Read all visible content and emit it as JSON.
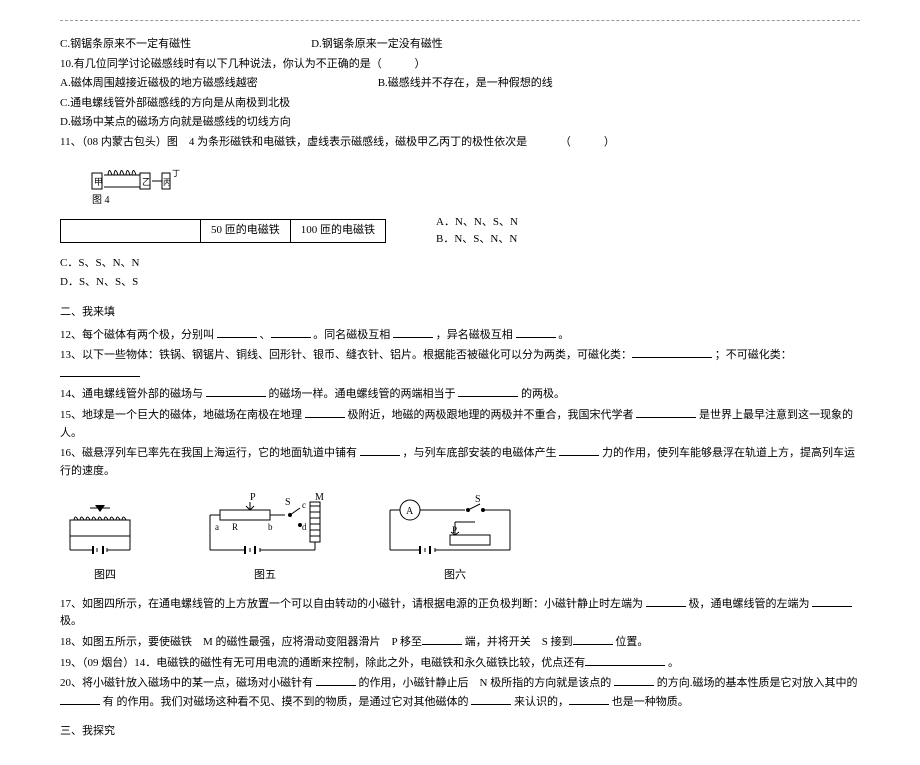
{
  "q9": {
    "c": "C.钢锯条原来不一定有磁性",
    "d": "D.钢锯条原来一定没有磁性"
  },
  "q10": {
    "stem": "10.有几位同学讨论磁感线时有以下几种说法，你认为不正确的是（",
    "closep": "）",
    "a": "A.磁体周围越接近磁极的地方磁感线越密",
    "b": "B.磁感线并不存在，是一种假想的线",
    "c": "C.通电螺线管外部磁感线的方向是从南极到北极",
    "d": "D.磁场中某点的磁场方向就是磁感线的切线方向"
  },
  "q11": {
    "stem": "11、（08 内蒙古包头）图　4 为条形磁铁和电磁铁，虚线表示磁感线，磁极甲乙丙丁的极性依次是",
    "paren": "（　　　）",
    "fig_label": "图 4",
    "th1": "50 匝的电磁铁",
    "th2": "100 匝的电磁铁",
    "optA": "A．N、N、S、N",
    "optB": "B．N、S、N、N",
    "optC": "C．S、S、N、N",
    "optD": "D．S、N、S、S"
  },
  "sec2": "二、我来填",
  "q12": {
    "p1": "12、每个磁体有两个极，分别叫 ",
    "p2": "、",
    "p3": "。同名磁极互相 ",
    "p4": "，异名磁极互相 ",
    "p5": "。"
  },
  "q13": {
    "p1": "13、以下一些物体：铁锅、钢锯片、铜线、回形针、银币、缝衣针、铝片。根据能否被磁化可以分为两类，可磁化类：",
    "p2": "；不可磁化类："
  },
  "q14": {
    "p1": "14、通电螺线管外部的磁场与 ",
    "p2": "的磁场一样。通电螺线管的两端相当于 ",
    "p3": "的两极。"
  },
  "q15": {
    "p1": "15、地球是一个巨大的磁体，地磁场在南极在地理 ",
    "p2": "极附近，地磁的两极跟地理的两极并不重合，我国宋代学者 ",
    "p3": "是世界上最早注意到这一现象的人。"
  },
  "q16": {
    "p1": "16、磁悬浮列车已率先在我国上海运行，它的地面轨道中铺有 ",
    "p2": "，与列车底部安装的电磁体产生 ",
    "p3": "力的作用，使列车能够悬浮在轨道上方，提高列车运行的速度。"
  },
  "figs": {
    "f4": "图四",
    "f5": "图五",
    "f6": "图六"
  },
  "q17": {
    "p1": "17、如图四所示，在通电螺线管的上方放置一个可以自由转动的小磁针，请根据电源的正负极判断：小磁针静止时左端为 ",
    "p2": "极，通电螺线管的左端为 ",
    "p3": "极。"
  },
  "q18": {
    "p1": "18、如图五所示，要使磁铁　M 的磁性最强，应将滑动变阻器滑片　P 移至",
    "p2": "端，并将开关　S 接到",
    "p3": "位置。"
  },
  "q19": {
    "p1": "19、（09 烟台）14．电磁铁的磁性有无可用电流的通断来控制，除此之外，电磁铁和永久磁铁比较，优点还有",
    "p2": "。"
  },
  "q20": {
    "p1": "20、将小磁针放入磁场中的某一点，磁场对小磁针有 ",
    "p2": "的作用，小磁针静止后　N 极所指的方向就是该点的 ",
    "p3": "的方向.磁场的基本性质是它对放入其中的 ",
    "p4": "有",
    "p5": "的作用。我们对磁场这种看不见、摸不到的物质，是通过它对其他磁体的 ",
    "p6": "来认识的，",
    "p7": "也是一种物质。"
  },
  "sec3": "三、我探究"
}
